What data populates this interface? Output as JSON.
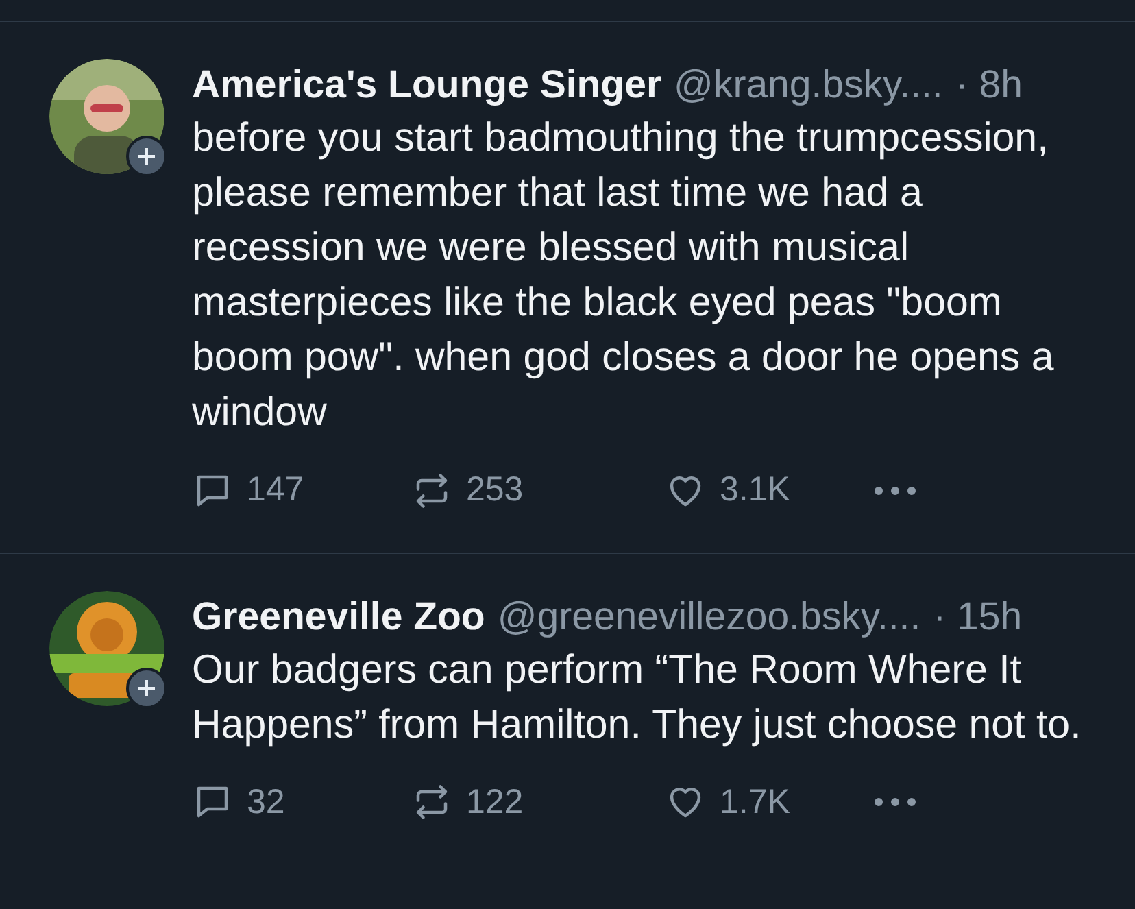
{
  "posts": [
    {
      "name": "America's Lounge Singer",
      "handle": "@krang.bsky....",
      "time": "· 8h",
      "text": "before you start badmouthing the trumpcession, please remember that last time we had a recession we were blessed with musical masterpieces like the black eyed peas \"boom boom pow\". when god closes a door he opens a window",
      "replies": "147",
      "reposts": "253",
      "likes": "3.1K"
    },
    {
      "name": "Greeneville Zoo",
      "handle": "@greenevillezoo.bsky....",
      "time": "· 15h",
      "text": "Our badgers can perform “The Room Where It Happens” from Hamilton. They just choose not to.",
      "replies": "32",
      "reposts": "122",
      "likes": "1.7K"
    }
  ]
}
